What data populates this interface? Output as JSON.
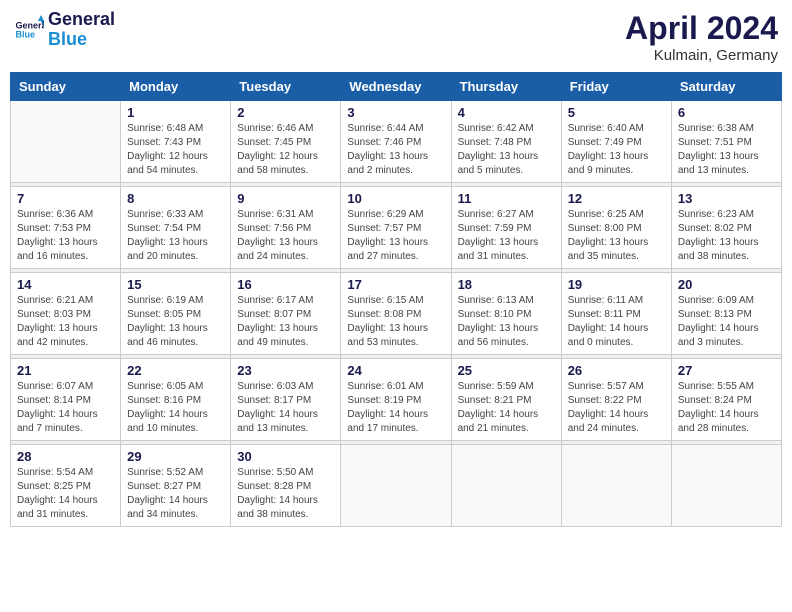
{
  "logo": {
    "name": "General",
    "name2": "Blue"
  },
  "header": {
    "month": "April 2024",
    "location": "Kulmain, Germany"
  },
  "days_of_week": [
    "Sunday",
    "Monday",
    "Tuesday",
    "Wednesday",
    "Thursday",
    "Friday",
    "Saturday"
  ],
  "weeks": [
    [
      {
        "day": "",
        "info": ""
      },
      {
        "day": "1",
        "info": "Sunrise: 6:48 AM\nSunset: 7:43 PM\nDaylight: 12 hours\nand 54 minutes."
      },
      {
        "day": "2",
        "info": "Sunrise: 6:46 AM\nSunset: 7:45 PM\nDaylight: 12 hours\nand 58 minutes."
      },
      {
        "day": "3",
        "info": "Sunrise: 6:44 AM\nSunset: 7:46 PM\nDaylight: 13 hours\nand 2 minutes."
      },
      {
        "day": "4",
        "info": "Sunrise: 6:42 AM\nSunset: 7:48 PM\nDaylight: 13 hours\nand 5 minutes."
      },
      {
        "day": "5",
        "info": "Sunrise: 6:40 AM\nSunset: 7:49 PM\nDaylight: 13 hours\nand 9 minutes."
      },
      {
        "day": "6",
        "info": "Sunrise: 6:38 AM\nSunset: 7:51 PM\nDaylight: 13 hours\nand 13 minutes."
      }
    ],
    [
      {
        "day": "7",
        "info": "Sunrise: 6:36 AM\nSunset: 7:53 PM\nDaylight: 13 hours\nand 16 minutes."
      },
      {
        "day": "8",
        "info": "Sunrise: 6:33 AM\nSunset: 7:54 PM\nDaylight: 13 hours\nand 20 minutes."
      },
      {
        "day": "9",
        "info": "Sunrise: 6:31 AM\nSunset: 7:56 PM\nDaylight: 13 hours\nand 24 minutes."
      },
      {
        "day": "10",
        "info": "Sunrise: 6:29 AM\nSunset: 7:57 PM\nDaylight: 13 hours\nand 27 minutes."
      },
      {
        "day": "11",
        "info": "Sunrise: 6:27 AM\nSunset: 7:59 PM\nDaylight: 13 hours\nand 31 minutes."
      },
      {
        "day": "12",
        "info": "Sunrise: 6:25 AM\nSunset: 8:00 PM\nDaylight: 13 hours\nand 35 minutes."
      },
      {
        "day": "13",
        "info": "Sunrise: 6:23 AM\nSunset: 8:02 PM\nDaylight: 13 hours\nand 38 minutes."
      }
    ],
    [
      {
        "day": "14",
        "info": "Sunrise: 6:21 AM\nSunset: 8:03 PM\nDaylight: 13 hours\nand 42 minutes."
      },
      {
        "day": "15",
        "info": "Sunrise: 6:19 AM\nSunset: 8:05 PM\nDaylight: 13 hours\nand 46 minutes."
      },
      {
        "day": "16",
        "info": "Sunrise: 6:17 AM\nSunset: 8:07 PM\nDaylight: 13 hours\nand 49 minutes."
      },
      {
        "day": "17",
        "info": "Sunrise: 6:15 AM\nSunset: 8:08 PM\nDaylight: 13 hours\nand 53 minutes."
      },
      {
        "day": "18",
        "info": "Sunrise: 6:13 AM\nSunset: 8:10 PM\nDaylight: 13 hours\nand 56 minutes."
      },
      {
        "day": "19",
        "info": "Sunrise: 6:11 AM\nSunset: 8:11 PM\nDaylight: 14 hours\nand 0 minutes."
      },
      {
        "day": "20",
        "info": "Sunrise: 6:09 AM\nSunset: 8:13 PM\nDaylight: 14 hours\nand 3 minutes."
      }
    ],
    [
      {
        "day": "21",
        "info": "Sunrise: 6:07 AM\nSunset: 8:14 PM\nDaylight: 14 hours\nand 7 minutes."
      },
      {
        "day": "22",
        "info": "Sunrise: 6:05 AM\nSunset: 8:16 PM\nDaylight: 14 hours\nand 10 minutes."
      },
      {
        "day": "23",
        "info": "Sunrise: 6:03 AM\nSunset: 8:17 PM\nDaylight: 14 hours\nand 13 minutes."
      },
      {
        "day": "24",
        "info": "Sunrise: 6:01 AM\nSunset: 8:19 PM\nDaylight: 14 hours\nand 17 minutes."
      },
      {
        "day": "25",
        "info": "Sunrise: 5:59 AM\nSunset: 8:21 PM\nDaylight: 14 hours\nand 21 minutes."
      },
      {
        "day": "26",
        "info": "Sunrise: 5:57 AM\nSunset: 8:22 PM\nDaylight: 14 hours\nand 24 minutes."
      },
      {
        "day": "27",
        "info": "Sunrise: 5:55 AM\nSunset: 8:24 PM\nDaylight: 14 hours\nand 28 minutes."
      }
    ],
    [
      {
        "day": "28",
        "info": "Sunrise: 5:54 AM\nSunset: 8:25 PM\nDaylight: 14 hours\nand 31 minutes."
      },
      {
        "day": "29",
        "info": "Sunrise: 5:52 AM\nSunset: 8:27 PM\nDaylight: 14 hours\nand 34 minutes."
      },
      {
        "day": "30",
        "info": "Sunrise: 5:50 AM\nSunset: 8:28 PM\nDaylight: 14 hours\nand 38 minutes."
      },
      {
        "day": "",
        "info": ""
      },
      {
        "day": "",
        "info": ""
      },
      {
        "day": "",
        "info": ""
      },
      {
        "day": "",
        "info": ""
      }
    ]
  ]
}
